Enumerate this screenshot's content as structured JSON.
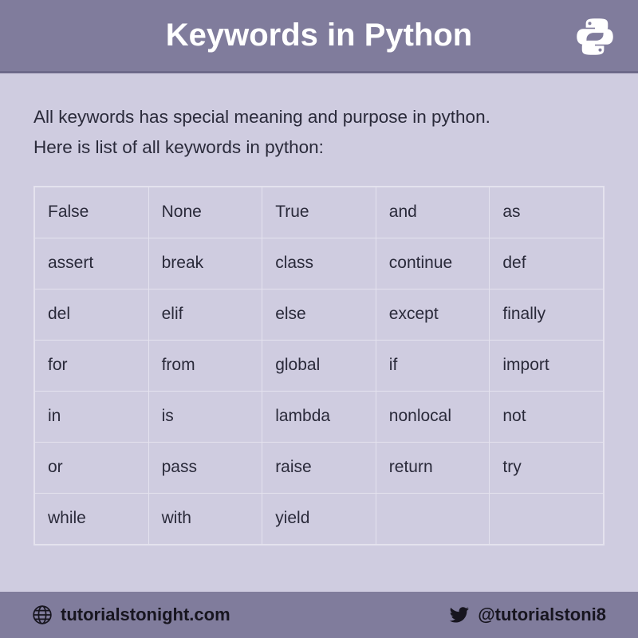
{
  "header": {
    "title": "Keywords in Python"
  },
  "description": {
    "line1": "All keywords has special meaning and purpose in python.",
    "line2": "Here is list of all keywords in python:"
  },
  "keywords": [
    [
      "False",
      "None",
      "True",
      "and",
      "as"
    ],
    [
      "assert",
      "break",
      "class",
      "continue",
      "def"
    ],
    [
      "del",
      "elif",
      "else",
      "except",
      "finally"
    ],
    [
      "for",
      "from",
      "global",
      "if",
      "import"
    ],
    [
      "in",
      "is",
      "lambda",
      "nonlocal",
      "not"
    ],
    [
      "or",
      "pass",
      "raise",
      "return",
      "try"
    ],
    [
      "while",
      "with",
      "yield",
      "",
      ""
    ]
  ],
  "footer": {
    "website": "tutorialstonight.com",
    "twitter": "@tutorialstoni8"
  }
}
